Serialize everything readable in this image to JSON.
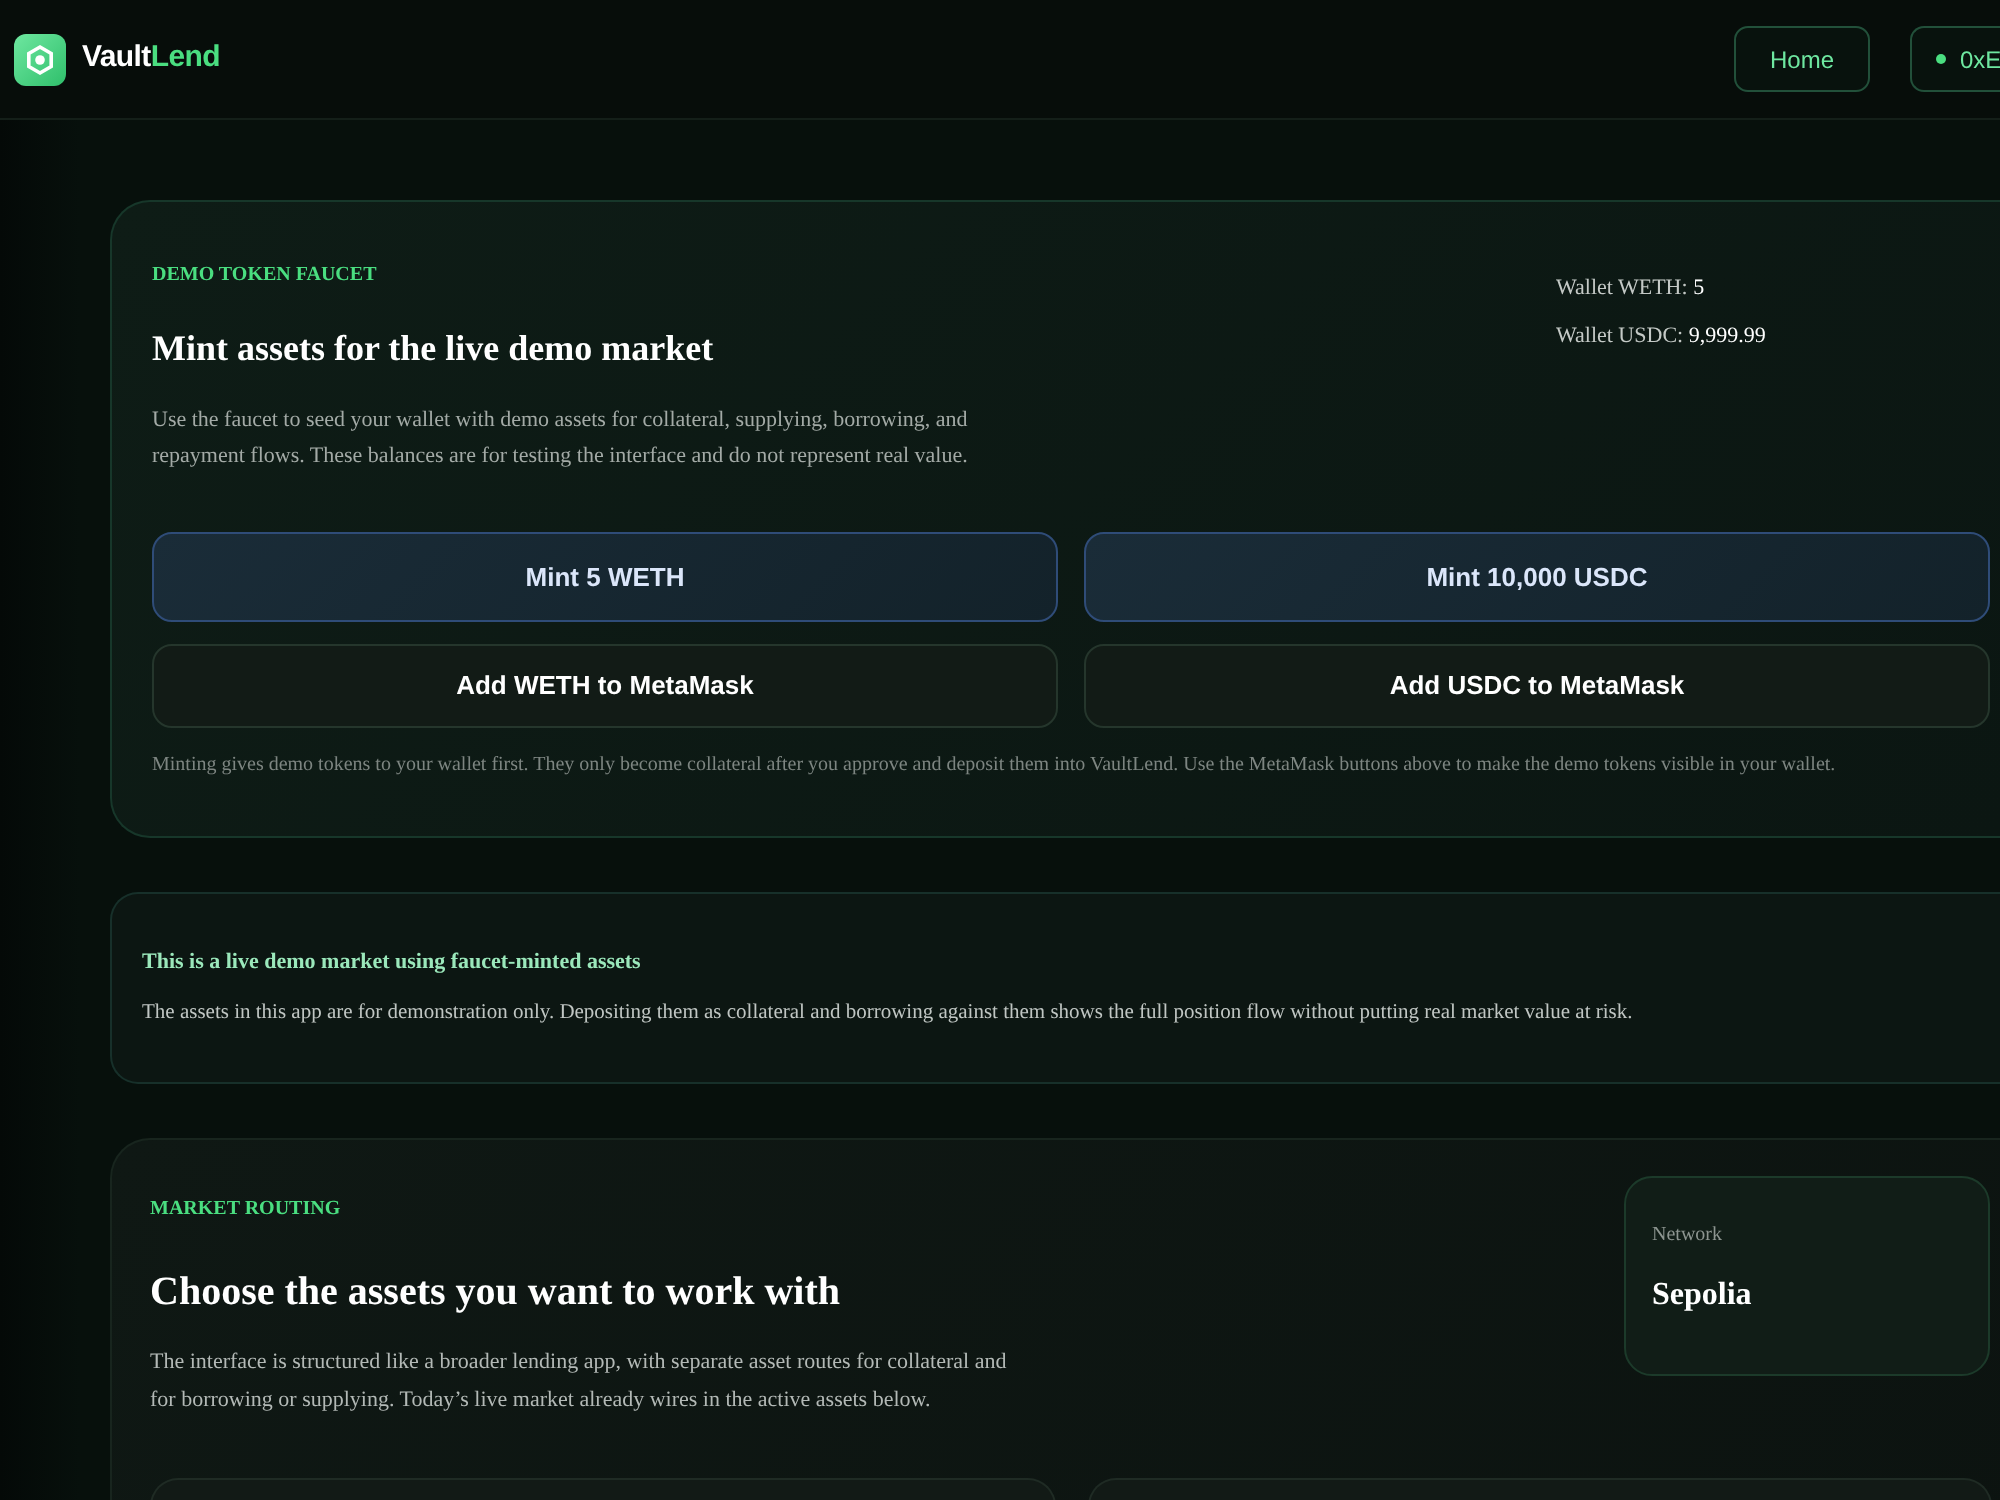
{
  "header": {
    "brand": {
      "first": "Vault",
      "second": "Lend"
    },
    "nav": [
      {
        "label": "Home"
      }
    ],
    "wallet": {
      "label": "0xE"
    }
  },
  "faucet": {
    "eyebrow": "DEMO TOKEN FAUCET",
    "title": "Mint assets for the live demo market",
    "description": "Use the faucet to seed your wallet with demo assets for collateral, supplying, borrowing, and repayment flows. These balances are for testing the interface and do not represent real value.",
    "balances": [
      {
        "label": "Wallet WETH:",
        "value": "5"
      },
      {
        "label": "Wallet USDC:",
        "value": "9,999.99"
      }
    ],
    "buttons": [
      {
        "label": "Mint 5 WETH",
        "kind": "primary"
      },
      {
        "label": "Mint 10,000 USDC",
        "kind": "primary"
      },
      {
        "label": "Add WETH to MetaMask",
        "kind": "secondary"
      },
      {
        "label": "Add USDC to MetaMask",
        "kind": "secondary"
      }
    ],
    "note": "Minting gives demo tokens to your wallet first. They only become collateral after you approve and deposit them into VaultLend. Use the MetaMask buttons above to make the demo tokens visible in your wallet."
  },
  "notice": {
    "title": "This is a live demo market using faucet-minted assets",
    "body": "The assets in this app are for demonstration only. Depositing them as collateral and borrowing against them shows the full position flow without putting real market value at risk."
  },
  "routing": {
    "eyebrow": "MARKET ROUTING",
    "title": "Choose the assets you want to work with",
    "description": "The interface is structured like a broader lending app, with separate asset routes for collateral and for borrowing or supplying. Today’s live market already wires in the active assets below.",
    "network": {
      "label": "Network",
      "value": "Sepolia"
    }
  }
}
